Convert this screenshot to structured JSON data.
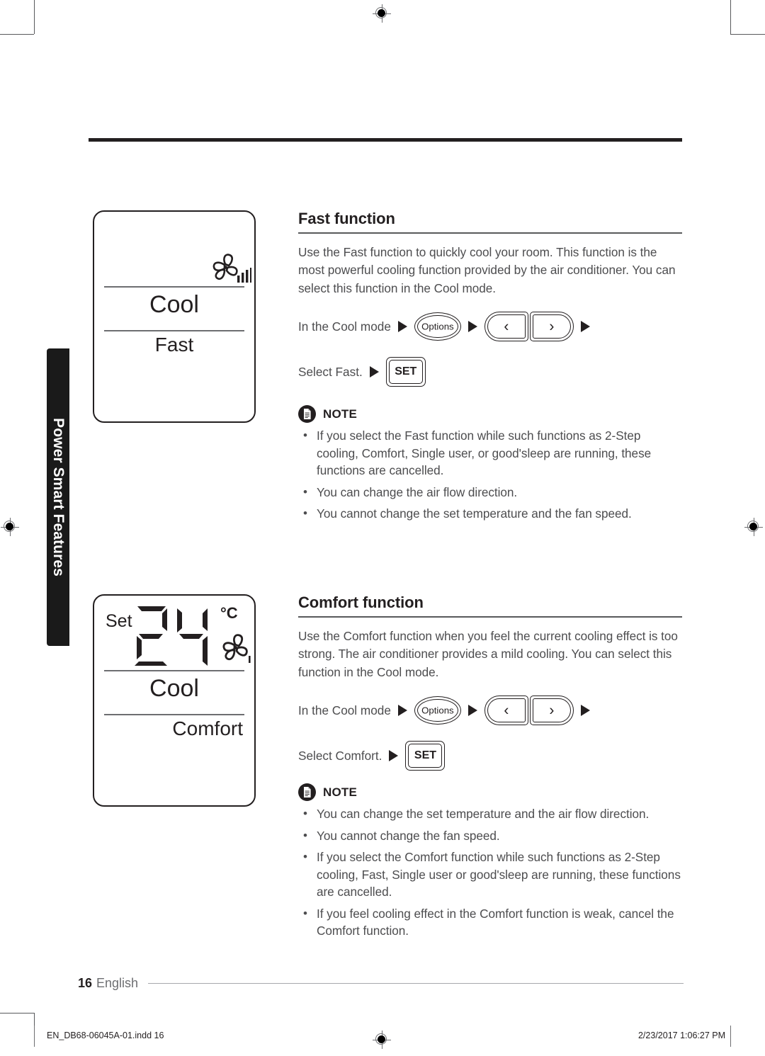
{
  "side_tab": {
    "label": "Power Smart Features"
  },
  "displays": [
    {
      "name": "fast-display",
      "mode": "Cool",
      "function": "Fast",
      "fan_icon": "fan-speed-icon",
      "fan_bars": 4
    },
    {
      "name": "comfort-display",
      "set_label": "Set",
      "temperature": "24",
      "unit": "°C",
      "mode": "Cool",
      "function": "Comfort",
      "fan_icon": "fan-speed-icon",
      "fan_bars": 1
    }
  ],
  "sections": [
    {
      "title": "Fast function",
      "body": "Use the Fast function to quickly cool your room. This function is the most powerful cooling function provided by the air conditioner. You can select this function in the Cool mode.",
      "step1": {
        "label": "In the Cool mode",
        "options_button": "Options",
        "left_chevron": "‹",
        "right_chevron": "›"
      },
      "step2": {
        "label": "Select Fast.",
        "set_button": "SET"
      },
      "note_label": "NOTE",
      "notes": [
        "If you select the Fast function while such functions as 2-Step cooling, Comfort, Single user, or good'sleep are running, these functions are cancelled.",
        "You can change the air flow direction.",
        "You cannot change the set temperature and the fan speed."
      ]
    },
    {
      "title": "Comfort function",
      "body": "Use the Comfort function when you feel the current cooling  effect is too strong. The air conditioner provides a mild cooling. You can select this function in the Cool mode.",
      "step1": {
        "label": "In the Cool mode",
        "options_button": "Options",
        "left_chevron": "‹",
        "right_chevron": "›"
      },
      "step2": {
        "label": "Select Comfort.",
        "set_button": "SET"
      },
      "note_label": "NOTE",
      "notes": [
        "You can change the set temperature and the air flow direction.",
        "You cannot change the fan speed.",
        "If you select the Comfort function while such functions as 2-Step cooling, Fast, Single user or good'sleep are running, these functions are cancelled.",
        "If you feel cooling effect in the Comfort function is weak, cancel the Comfort function."
      ]
    }
  ],
  "footer": {
    "page_number": "16",
    "language": "English"
  },
  "print_marks": {
    "file_name": "EN_DB68-06045A-01.indd   16",
    "timestamp": "2/23/2017   1:06:27 PM"
  },
  "colors": {
    "ink": "#231f20",
    "body_text": "#4d4d4f",
    "rule": "#58595b",
    "tab_background": "#1a1a1a"
  }
}
